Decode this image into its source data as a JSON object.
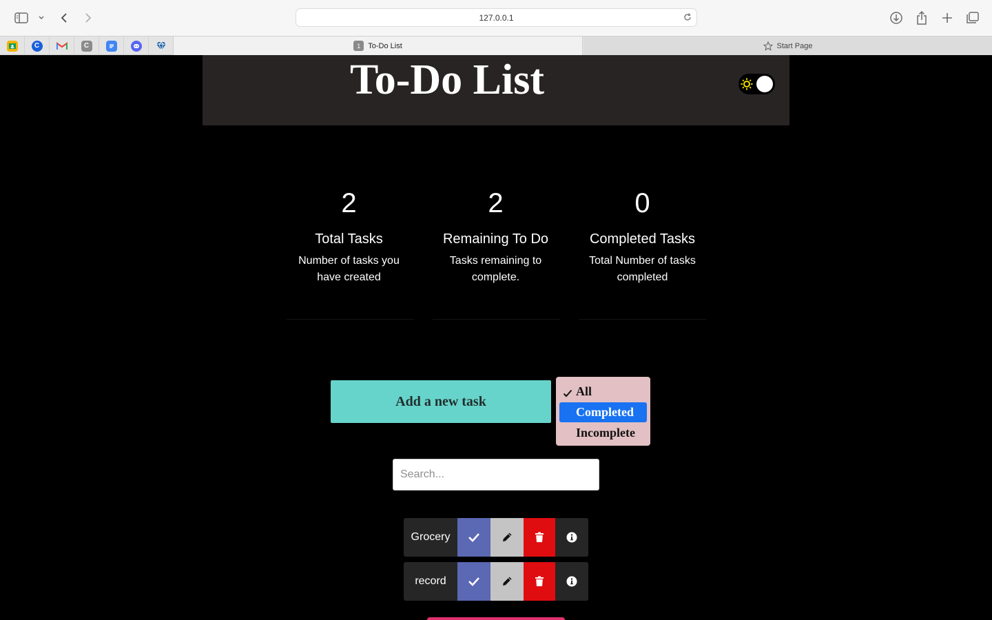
{
  "browser": {
    "url": "127.0.0.1",
    "active_tab": {
      "number": "1",
      "title": "To-Do List"
    },
    "inactive_tab": {
      "title": "Start Page"
    },
    "favorites": [
      {
        "name": "Google Classroom",
        "color": "#f4b400",
        "glyph": ""
      },
      {
        "name": "Google Search",
        "color": "#1a5fd8",
        "glyph": "C"
      },
      {
        "name": "Gmail",
        "color": "#ffffff",
        "glyph": "M"
      },
      {
        "name": "Canvas",
        "color": "#8b8b8b",
        "glyph": "C"
      },
      {
        "name": "Google Docs",
        "color": "#4285f4",
        "glyph": ""
      },
      {
        "name": "Discord",
        "color": "#5865f2",
        "glyph": ""
      },
      {
        "name": "Bookmark",
        "color": "#ffffff",
        "glyph": ""
      }
    ]
  },
  "header": {
    "title": "To-Do List",
    "theme_toggle": {
      "icon": "sun-icon",
      "state": "dark"
    }
  },
  "stats": [
    {
      "value": "2",
      "label": "Total Tasks",
      "description": "Number of tasks you have created"
    },
    {
      "value": "2",
      "label": "Remaining To Do",
      "description": "Tasks remaining to complete."
    },
    {
      "value": "0",
      "label": "Completed Tasks",
      "description": "Total Number of tasks completed"
    }
  ],
  "add_task": {
    "label": "Add a new task"
  },
  "filter": {
    "options": [
      "All",
      "Completed",
      "Incomplete"
    ],
    "checked": "All",
    "highlighted": "Completed"
  },
  "search": {
    "placeholder": "Search...",
    "value": ""
  },
  "tasks": [
    {
      "name": "Grocery"
    },
    {
      "name": "record"
    }
  ],
  "colors": {
    "accent_teal": "#67d4cb",
    "complete_blue": "#5b68b3",
    "delete_red": "#e00d10",
    "edit_grey": "#c4c4c4",
    "header_bg": "#282424",
    "filter_bg": "#e2c0c4",
    "filter_highlight": "#1872f2"
  }
}
